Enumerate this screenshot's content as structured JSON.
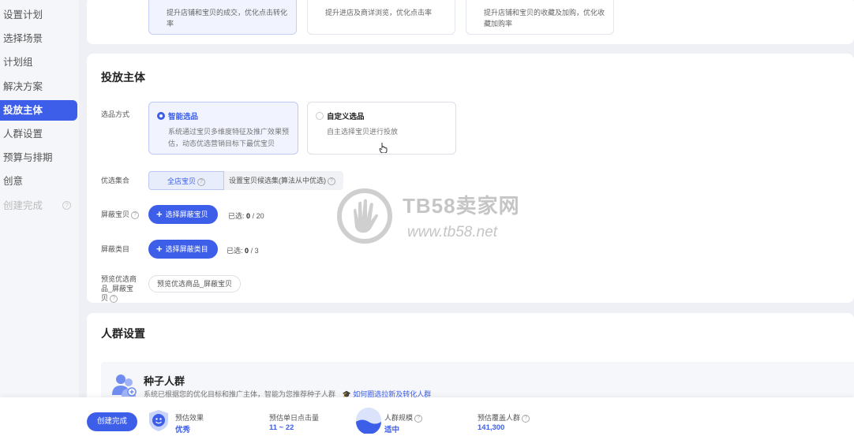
{
  "sidebar": {
    "items": [
      {
        "label": "设置计划"
      },
      {
        "label": "选择场景"
      },
      {
        "label": "计划组"
      },
      {
        "label": "解决方案"
      },
      {
        "label": "投放主体",
        "active": true
      },
      {
        "label": "人群设置"
      },
      {
        "label": "预算与排期"
      },
      {
        "label": "创意"
      },
      {
        "label": "创建完成",
        "disabled": true
      }
    ]
  },
  "goals": [
    {
      "desc": "提升店铺和宝贝的成交，优化点击转化率",
      "selected": true
    },
    {
      "desc": "提升进店及商详浏览，优化点击率"
    },
    {
      "desc": "提升店铺和宝贝的收藏及加购，优化收藏加购率"
    }
  ],
  "subject": {
    "title": "投放主体",
    "selection_label": "选品方式",
    "options": [
      {
        "title": "智能选品",
        "desc": "系统通过宝贝多维度特征及推广效果预估，动态优选营销目标下最优宝贝",
        "selected": true
      },
      {
        "title": "自定义选品",
        "desc": "自主选择宝贝进行投放"
      }
    ],
    "pool_label": "优选集合",
    "pool_active": "全店宝贝",
    "pool_inactive": "设置宝贝候选集(算法从中优选)",
    "blocked_items_label": "屏蔽宝贝",
    "blocked_items_button": "选择屏蔽宝贝",
    "blocked_items_prefix": "已选:",
    "blocked_items_count": "0",
    "blocked_items_max": "/ 20",
    "blocked_cat_label": "屏蔽类目",
    "blocked_cat_button": "选择屏蔽类目",
    "blocked_cat_prefix": "已选:",
    "blocked_cat_count": "0",
    "blocked_cat_max": "/ 3",
    "preview_label_l1": "预览优选商",
    "preview_label_l2": "品_屏蔽宝",
    "preview_label_l3": "贝",
    "preview_button": "预览优选商品_屏蔽宝贝"
  },
  "audience": {
    "title": "人群设置",
    "seed_title": "种子人群",
    "seed_desc": "系统已根据您的优化目标和推广主体，智能为您推荐种子人群",
    "seed_link": "如何圈选拉新及转化人群"
  },
  "bottom": {
    "create_button": "创建完成",
    "metrics": [
      {
        "label": "预估效果",
        "value": "优秀"
      },
      {
        "label": "预估单日点击量",
        "value": "11 ~ 22"
      },
      {
        "label": "人群规模",
        "value": "适中"
      },
      {
        "label": "预估覆盖人群",
        "value": "141,300"
      }
    ]
  },
  "watermark": {
    "line1": "TB58卖家网",
    "line2": "www.tb58.net"
  },
  "colors": {
    "accent": "#3d5ee8"
  }
}
